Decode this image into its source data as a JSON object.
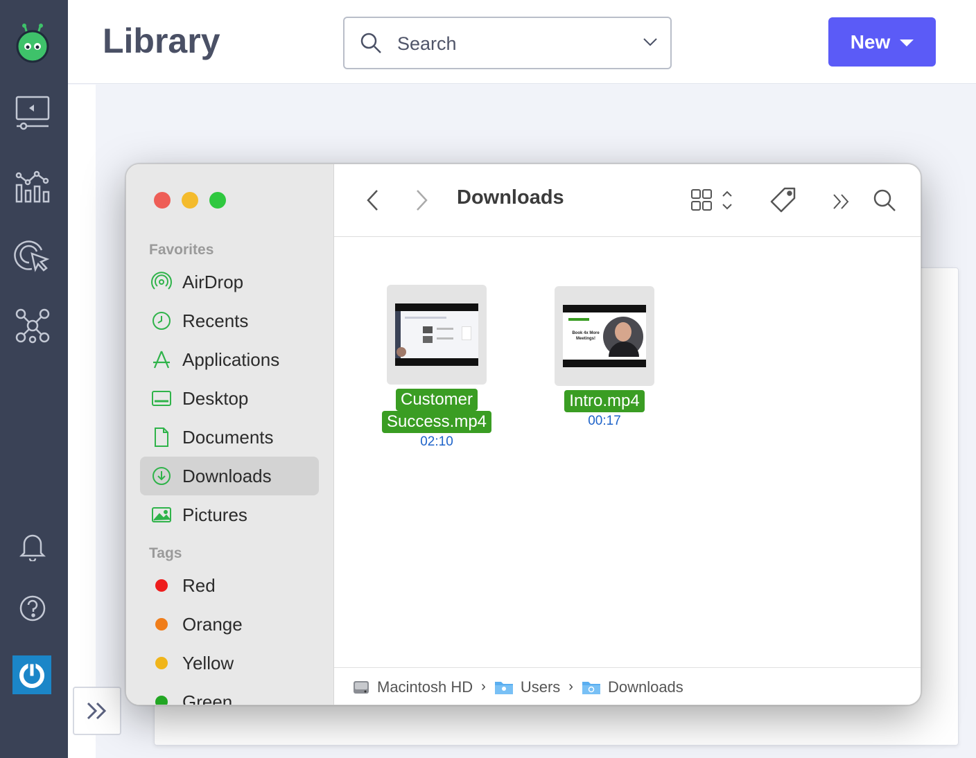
{
  "app": {
    "page_title": "Library",
    "search": {
      "placeholder": "Search"
    },
    "new_button": {
      "label": "New"
    },
    "rail_icons": [
      "app-logo-icon",
      "video-player-icon",
      "analytics-icon",
      "target-icon",
      "network-icon",
      "bell-icon",
      "help-icon",
      "power-icon"
    ]
  },
  "finder": {
    "title": "Downloads",
    "sidebar": {
      "favorites_header": "Favorites",
      "favorites": [
        {
          "label": "AirDrop",
          "icon": "airdrop-icon"
        },
        {
          "label": "Recents",
          "icon": "clock-icon"
        },
        {
          "label": "Applications",
          "icon": "applications-icon"
        },
        {
          "label": "Desktop",
          "icon": "desktop-icon"
        },
        {
          "label": "Documents",
          "icon": "document-icon"
        },
        {
          "label": "Downloads",
          "icon": "download-icon",
          "selected": true
        },
        {
          "label": "Pictures",
          "icon": "pictures-icon"
        }
      ],
      "tags_header": "Tags",
      "tags": [
        {
          "label": "Red",
          "color": "#ee1d1d"
        },
        {
          "label": "Orange",
          "color": "#f07d1a"
        },
        {
          "label": "Yellow",
          "color": "#f0b51a"
        },
        {
          "label": "Green",
          "color": "#22a623"
        }
      ]
    },
    "files": [
      {
        "name_line1": "Customer",
        "name_line2": "Success.mp4",
        "duration": "02:10"
      },
      {
        "name_line1": "Intro.mp4",
        "duration": "00:17",
        "thumb_text": "Book 4x More Meetings!"
      }
    ],
    "path": [
      "Macintosh HD",
      "Users",
      "Downloads"
    ]
  },
  "colors": {
    "accent": "#5b5bf7",
    "rail": "#3a4256",
    "finder_green": "#3a9d23"
  }
}
